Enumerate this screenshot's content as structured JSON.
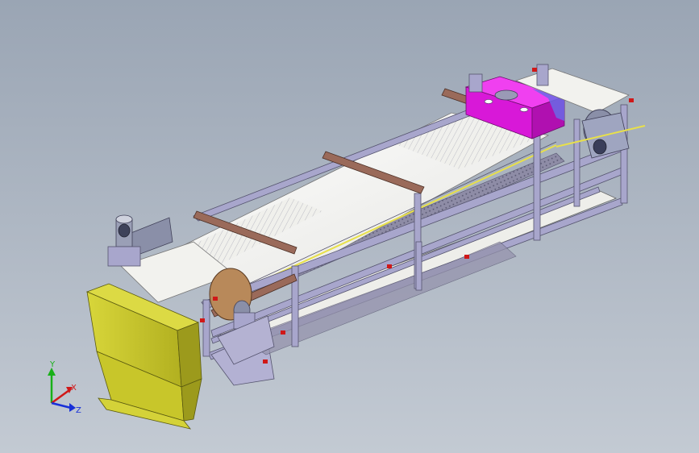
{
  "viewport": {
    "background_top": "#9aa5b4",
    "background_bottom": "#c3cad3"
  },
  "model": {
    "frame_color": "#a8a6cc",
    "frame_edge_color": "#55546e",
    "belt_color": "#f2f2ee",
    "hopper_color": "#c8c62a",
    "hopper_shade_color": "#9c9a1c",
    "spray_box_color": "#e020e0",
    "guide_bar_color": "#9a6a5a",
    "drive_roller_color": "#b8895a",
    "motor_color": "#8a8fa8",
    "rail_highlight_color": "#e8e04a",
    "marker_color": "#d01818"
  },
  "triad": {
    "x_label": "X",
    "y_label": "Y",
    "z_label": "Z",
    "x_color": "#d01818",
    "y_color": "#18b018",
    "z_color": "#1830d8"
  }
}
